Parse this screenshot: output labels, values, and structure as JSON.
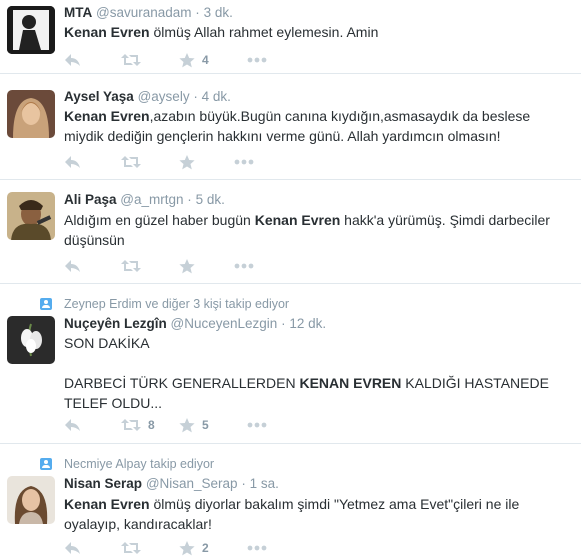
{
  "colors": {
    "link": "#55acee",
    "muted": "#8899a6",
    "icon": "#aab8c2",
    "text": "#292f33"
  },
  "tweets": [
    {
      "name": "MTA",
      "handle": "@savuranadam",
      "sep": "·",
      "time": "3 dk.",
      "text_bold": "Kenan Evren",
      "text_rest": " ölmüş Allah rahmet eylemesin. Amin",
      "retweets": "",
      "likes": "4"
    },
    {
      "name": "Aysel Yaşa",
      "handle": "@aysely",
      "sep": "·",
      "time": "4 dk.",
      "text_bold": "Kenan Evren",
      "text_rest": ",azabın büyük.Bugün canına kıydığın,asmasaydık da beslese miydik dediğin gençlerin hakkını verme günü. Allah yardımcın olmasın!",
      "retweets": "",
      "likes": ""
    },
    {
      "name": "Ali Paşa",
      "handle": "@a_mrtgn",
      "sep": "·",
      "time": "5 dk.",
      "text_pre": "Aldığım en güzel haber bugün ",
      "text_bold": "Kenan Evren",
      "text_rest": " hakk'a yürümüş. Şimdi darbeciler düşünsün",
      "retweets": "",
      "likes": ""
    },
    {
      "context": "Zeynep Erdim ve diğer 3 kişi takip ediyor",
      "name": "Nuçeyên Lezgîn",
      "handle": "@NuceyenLezgin",
      "sep": "·",
      "time": "12 dk.",
      "line1": "SON DAKİKA",
      "line2_pre": "DARBECİ TÜRK GENERALLERDEN ",
      "line2_bold": "KENAN EVREN",
      "line2_rest": " KALDIĞI HASTANEDE TELEF OLDU...",
      "retweets": "8",
      "likes": "5"
    },
    {
      "context": "Necmiye Alpay takip ediyor",
      "name": "Nisan Serap",
      "handle": "@Nisan_Serap",
      "sep": "·",
      "time": "1 sa.",
      "text_bold": "Kenan Evren",
      "text_rest": " ölmüş diyorlar bakalım şimdi \"Yetmez ama Evet\"çileri ne ile oyalayıp, kandıracaklar!",
      "retweets": "",
      "likes": "2"
    }
  ]
}
